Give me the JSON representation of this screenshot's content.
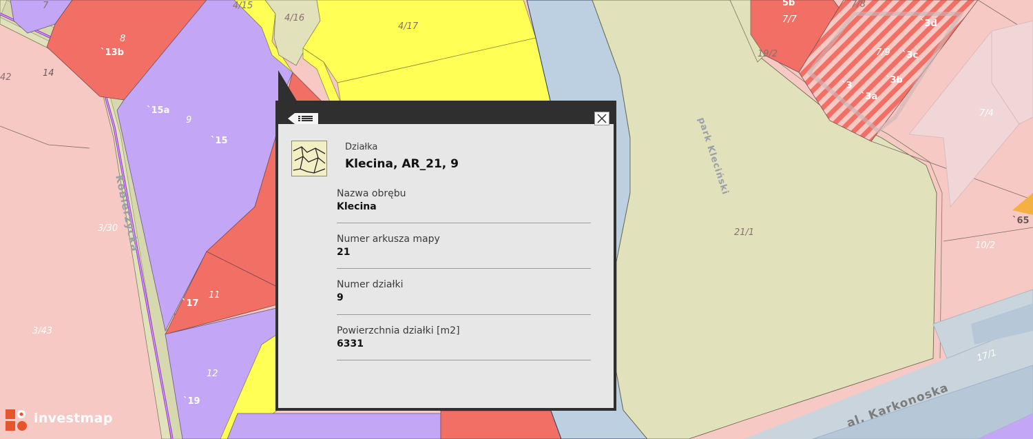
{
  "map": {
    "street_labels": [
      "al. Karkonoska",
      "Kobierzycka",
      "park Kleciński"
    ],
    "parcel_labels": [
      "7",
      "8",
      "`13b",
      "14",
      "42",
      "4/15",
      "4/16",
      "4/17",
      "`15a",
      "9",
      "`15",
      "3/30",
      "`17",
      "11",
      "3/43",
      "12",
      "`19",
      "5b",
      "7/7",
      "7/8",
      "`3d",
      "19/2",
      "7/9",
      "`3c",
      "`3b",
      "`3",
      "`3a",
      "7/4",
      "21/1",
      "`65",
      "10/2",
      "17/1"
    ],
    "colors": {
      "residential_pink": "#f7c9c4",
      "red": "#f26f66",
      "purple": "#c4a6f7",
      "yellow": "#ffff55",
      "water": "#bcd0e2",
      "park": "#e1e2bb",
      "road": "#c9d4dc",
      "path_purple": "#9d3fd0"
    }
  },
  "popup": {
    "kind": "Działka",
    "title": "Klecina, AR_21, 9",
    "fields": [
      {
        "label": "Nazwa obrębu",
        "value": "Klecina"
      },
      {
        "label": "Numer arkusza mapy",
        "value": "21"
      },
      {
        "label": "Numer działki",
        "value": "9"
      },
      {
        "label": "Powierzchnia działki [m2]",
        "value": "6331"
      }
    ],
    "back_icon": "list-back-icon",
    "close_icon": "close-icon",
    "parcel_icon": "parcel-map-icon"
  },
  "brand": {
    "name": "investmap"
  }
}
